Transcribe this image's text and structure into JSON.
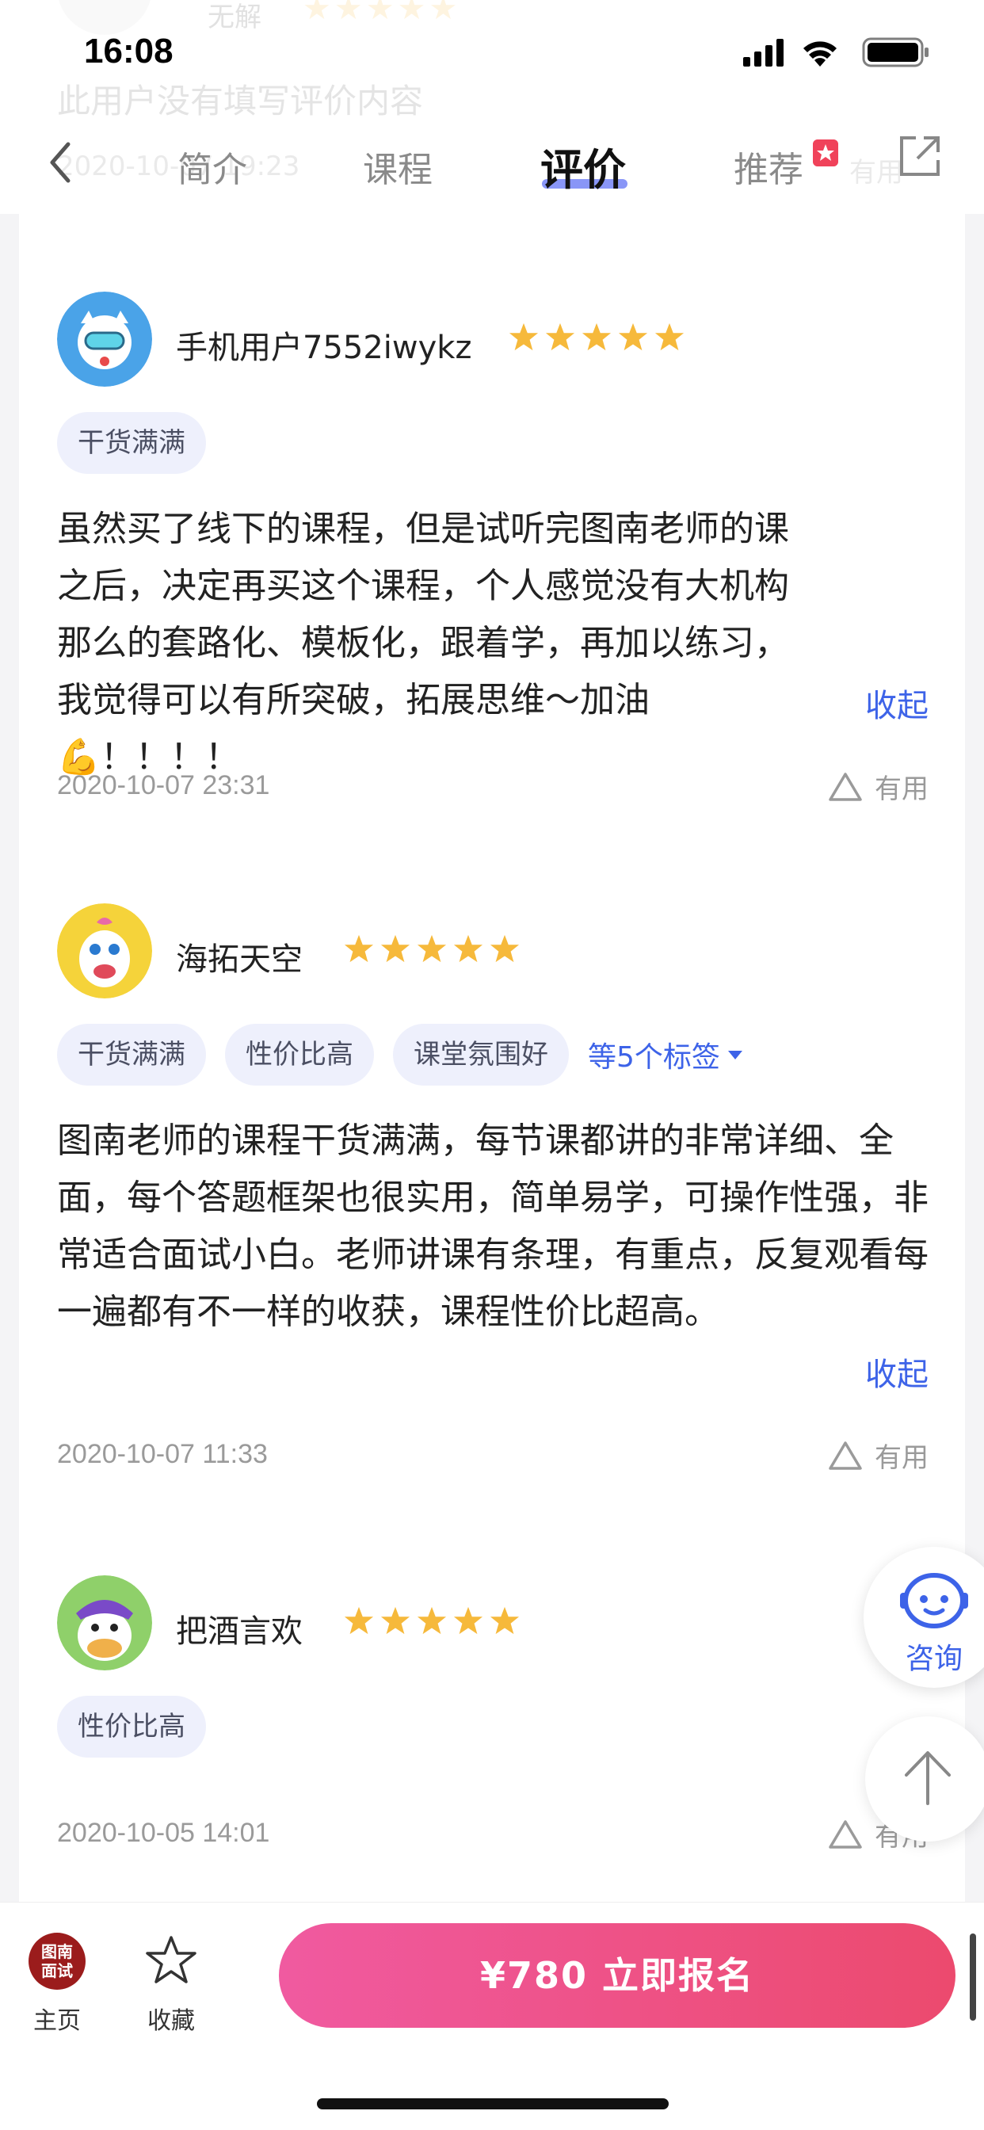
{
  "status_bar": {
    "time": "16:08"
  },
  "nav": {
    "tabs": [
      {
        "label": "简介"
      },
      {
        "label": "课程"
      },
      {
        "label": "评价"
      },
      {
        "label": "推荐"
      }
    ]
  },
  "ghost_review": {
    "name": "无解",
    "body": "此用户没有填写评价内容",
    "date": "2020-10-07 19:23",
    "useful": "有用"
  },
  "reviews": [
    {
      "name": "手机用户7552iwykz",
      "rating": 5,
      "tags": [
        "干货满满"
      ],
      "body": "虽然买了线下的课程，但是试听完图南老师的课之后，决定再买这个课程，个人感觉没有大机构那么的套路化、模板化，跟着学，再加以练习，我觉得可以有所突破，拓展思维～加油💪！！！！",
      "collapse": "收起",
      "date": "2020-10-07 23:31",
      "useful": "有用"
    },
    {
      "name": "海拓天空",
      "rating": 5,
      "tags": [
        "干货满满",
        "性价比高",
        "课堂氛围好"
      ],
      "more_tags": "等5个标签",
      "body": "图南老师的课程干货满满，每节课都讲的非常详细、全面，每个答题框架也很实用，简单易学，可操作性强，非常适合面试小白。老师讲课有条理，有重点，反复观看每一遍都有不一样的收获，课程性价比超高。",
      "collapse": "收起",
      "date": "2020-10-07 11:33",
      "useful": "有用"
    },
    {
      "name": "把酒言欢",
      "rating": 5,
      "tags": [
        "性价比高"
      ],
      "date": "2020-10-05 14:01",
      "useful": "有用"
    }
  ],
  "floating": {
    "consult_label": "咨询"
  },
  "bottom_bar": {
    "logo_text_1": "图南",
    "logo_text_2": "面试",
    "home_label": "主页",
    "fav_label": "收藏",
    "enroll_label": "¥780  立即报名"
  },
  "colors": {
    "accent": "#3d63e8",
    "star": "#f6b93b",
    "tag_bg": "#eef0fc",
    "enroll_gradient_start": "#f05aa0",
    "enroll_gradient_end": "#ec4a6e",
    "recommend_badge": "#f0425a"
  },
  "icons": [
    "back-arrow-icon",
    "share-icon",
    "star-icon",
    "thumb-triangle-icon",
    "consult-robot-icon",
    "arrow-up-icon",
    "favorite-star-icon",
    "signal-icon",
    "wifi-icon",
    "battery-icon"
  ]
}
